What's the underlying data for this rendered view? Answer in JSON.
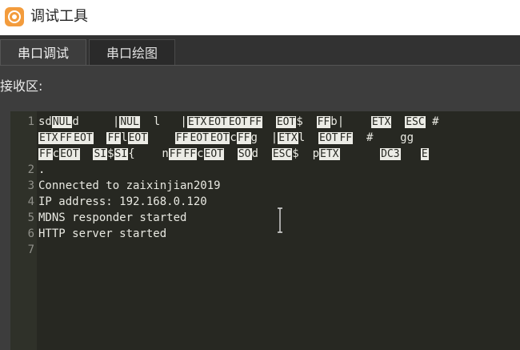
{
  "app": {
    "title": "调试工具",
    "icon": "serial-port-icon",
    "accent": "#f39c3d"
  },
  "tabs": [
    {
      "label": "串口调试",
      "active": true
    },
    {
      "label": "串口绘图",
      "active": false
    }
  ],
  "receive": {
    "label": "接收区:",
    "lines": [
      {
        "num": "1",
        "segments": [
          {
            "t": "sd"
          },
          {
            "t": "NUL",
            "ctl": true
          },
          {
            "t": "d     |"
          },
          {
            "t": "NUL",
            "ctl": true
          },
          {
            "t": "  l   |"
          },
          {
            "t": "ETX",
            "ctl": true
          },
          {
            "t": "EOT",
            "ctl": true
          },
          {
            "t": "EOT",
            "ctl": true
          },
          {
            "t": "FF",
            "ctl": true
          },
          {
            "t": "  "
          },
          {
            "t": "EOT",
            "ctl": true
          },
          {
            "t": "$  "
          },
          {
            "t": "FF",
            "ctl": true
          },
          {
            "t": "b|    "
          },
          {
            "t": "ETX",
            "ctl": true
          },
          {
            "t": "  "
          },
          {
            "t": "ESC",
            "ctl": true
          },
          {
            "t": " #"
          }
        ]
      },
      {
        "num": "",
        "segments": [
          {
            "t": "ETX",
            "ctl": true
          },
          {
            "t": "FF",
            "ctl": true
          },
          {
            "t": "EOT",
            "ctl": true
          },
          {
            "t": "  "
          },
          {
            "t": "FF",
            "ctl": true
          },
          {
            "t": "l"
          },
          {
            "t": "EOT",
            "ctl": true
          },
          {
            "t": "    "
          },
          {
            "t": "FF",
            "ctl": true
          },
          {
            "t": "EOT",
            "ctl": true
          },
          {
            "t": "EOT",
            "ctl": true
          },
          {
            "t": "c"
          },
          {
            "t": "FF",
            "ctl": true
          },
          {
            "t": "g  |"
          },
          {
            "t": "ETX",
            "ctl": true
          },
          {
            "t": "l  "
          },
          {
            "t": "EOT",
            "ctl": true
          },
          {
            "t": "FF",
            "ctl": true
          },
          {
            "t": "  #    gg"
          }
        ]
      },
      {
        "num": "",
        "segments": [
          {
            "t": "FF",
            "ctl": true
          },
          {
            "t": "c"
          },
          {
            "t": "EOT",
            "ctl": true
          },
          {
            "t": "  "
          },
          {
            "t": "SI",
            "ctl": true
          },
          {
            "t": "$"
          },
          {
            "t": "SI",
            "ctl": true
          },
          {
            "t": "{    n"
          },
          {
            "t": "FF",
            "ctl": true
          },
          {
            "t": "FF",
            "ctl": true
          },
          {
            "t": "c"
          },
          {
            "t": "EOT",
            "ctl": true
          },
          {
            "t": "  "
          },
          {
            "t": "SO",
            "ctl": true
          },
          {
            "t": "d  "
          },
          {
            "t": "ESC",
            "ctl": true
          },
          {
            "t": "$  p"
          },
          {
            "t": "ETX",
            "ctl": true
          },
          {
            "t": "      "
          },
          {
            "t": "DC3",
            "ctl": true
          },
          {
            "t": "   "
          },
          {
            "t": "E",
            "ctl": true
          }
        ]
      },
      {
        "num": "2",
        "segments": [
          {
            "t": "."
          }
        ]
      },
      {
        "num": "3",
        "segments": [
          {
            "t": "Connected to zaixinjian2019"
          }
        ]
      },
      {
        "num": "4",
        "segments": [
          {
            "t": "IP address: 192.168.0.120"
          }
        ]
      },
      {
        "num": "5",
        "segments": [
          {
            "t": "MDNS responder started"
          }
        ]
      },
      {
        "num": "6",
        "segments": [
          {
            "t": "HTTP server started"
          }
        ]
      },
      {
        "num": "7",
        "segments": [
          {
            "t": ""
          }
        ]
      }
    ]
  }
}
